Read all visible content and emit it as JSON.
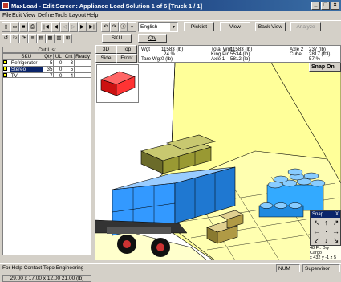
{
  "window": {
    "title": "MaxLoad - Edit Screen: Appliance Load Solution 1 of 6 [Truck 1 / 1]",
    "min": "_",
    "max": "□",
    "close": "×"
  },
  "menu": [
    "File",
    "Edit",
    "View",
    "Define",
    "Tools",
    "Layout",
    "Help"
  ],
  "toolbar": {
    "nav_prev_first": "|◀",
    "nav_prev": "◀",
    "nav_next": "▶",
    "nav_next_last": "▶|",
    "language": "English",
    "picklist": "Picklist",
    "view": "View",
    "back_view": "Back View",
    "analyze": "Analyze",
    "sku": "SKU",
    "qty": "Qty"
  },
  "cut_list": {
    "title": "Cut List",
    "columns": [
      "SKU",
      "Qty",
      "UL",
      "Cnt",
      "Ready"
    ],
    "rows": [
      {
        "sku": "Refrigerator",
        "qty": "5",
        "ul": "0",
        "cnt": "3",
        "ready": ""
      },
      {
        "sku": "Stereo",
        "qty": "35",
        "ul": "0",
        "cnt": "5",
        "ready": ""
      },
      {
        "sku": "TV",
        "qty": "7",
        "ul": "0",
        "cnt": "4",
        "ready": ""
      }
    ],
    "dimensions": "29.00 x 17.00 x 12.00  21.00 (lb)"
  },
  "view_tabs": {
    "t3d": "3D",
    "top": "Top",
    "side": "Side",
    "front": "Front"
  },
  "info": {
    "wgt_label": "Wgt",
    "wgt_value": "11583 (lb)",
    "wgt_pct": "24 %",
    "tare_label": "Tare Wgt",
    "tare_value": "0 (lb)",
    "total_label": "Total Wgt",
    "total_value": "11583 (lb)",
    "kingpin_label": "King Pin",
    "kingpin_value": "5534 (lb)",
    "axle1_label": "Axle 1",
    "axle1_value": "5812 (lb)",
    "axle2_label": "Axle 2",
    "axle2_value": "237 (lb)",
    "cube_label": "Cube",
    "cube_value": "2817 (ft3)",
    "cube_pct": "57 %"
  },
  "snap_on": "Snap On",
  "snap_panel": {
    "title": "Snap",
    "close": "X",
    "arrows": [
      "↖",
      "↑",
      "↗",
      "←",
      "·",
      "→",
      "↙",
      "↓",
      "↘"
    ]
  },
  "cargo": {
    "line1": "48 Ft. Dry Cargo",
    "line2": "x 432  y -1  z 5"
  },
  "status": {
    "help": "For Help Contact Topo Engineering",
    "num": "NUM",
    "user": "Supervisor"
  },
  "colors": {
    "title_bar": "#0a246a",
    "trailer_floor": "#ffff99",
    "refrigerator": "#3399ff",
    "stereo": "#999933",
    "tv": "#ffcc66",
    "drum": "#33aaff",
    "preview_box": "#ff3333"
  }
}
